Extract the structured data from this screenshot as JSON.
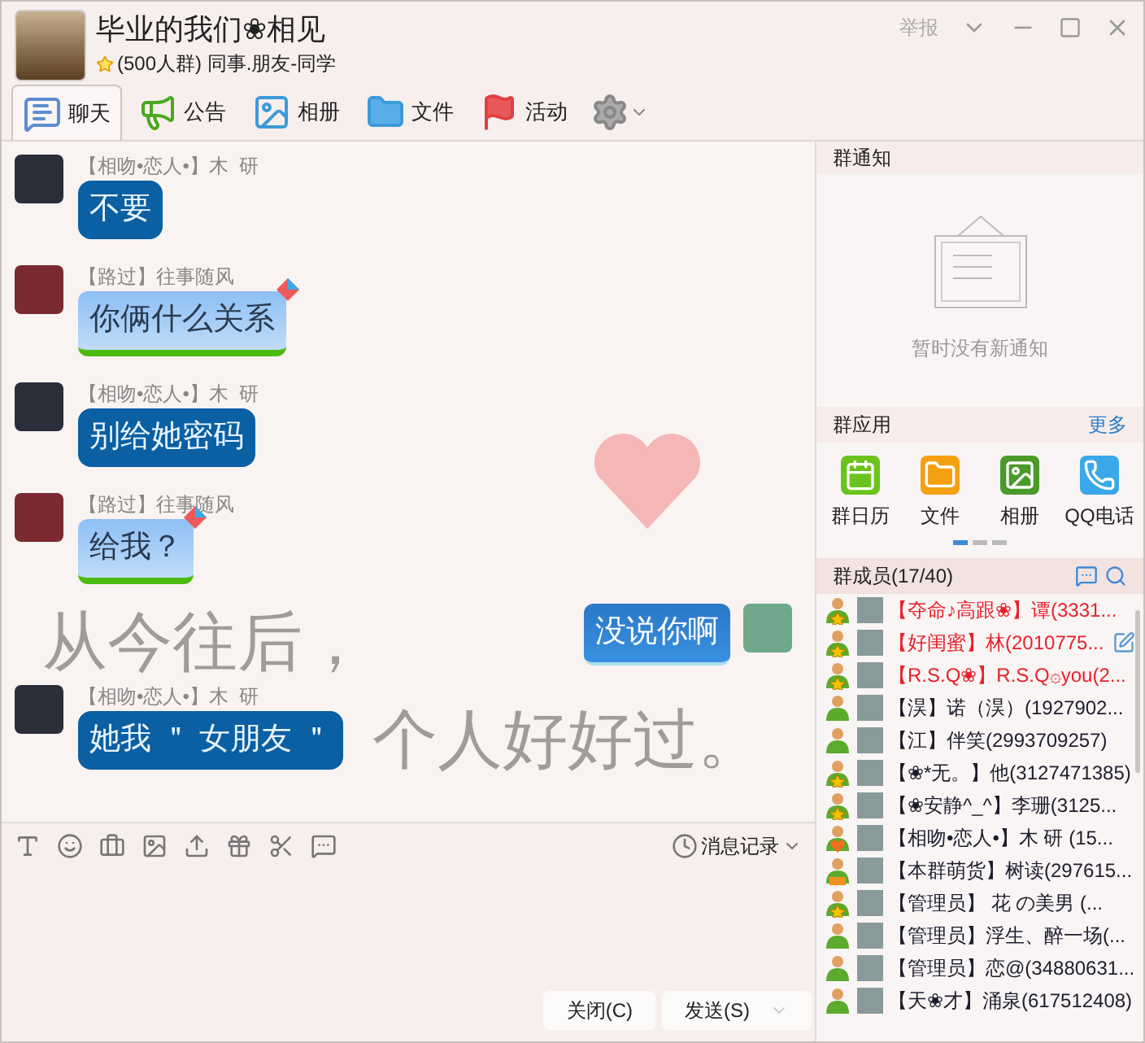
{
  "window": {
    "title": "毕业的我们❀相见",
    "subtitle": "(500人群) 同事.朋友-同学",
    "report": "举报"
  },
  "tabs": [
    {
      "label": "聊天",
      "selected": true
    },
    {
      "label": "公告",
      "selected": false
    },
    {
      "label": "相册",
      "selected": false
    },
    {
      "label": "文件",
      "selected": false
    },
    {
      "label": "活动",
      "selected": false
    }
  ],
  "wallpaper_text": [
    "从今往后，",
    "个人好好过。"
  ],
  "messages": [
    {
      "sender": "【相吻•恋人•】木  研",
      "text": "不要",
      "kind": "dark"
    },
    {
      "sender": "【路过】往事随风",
      "text": "你俩什么关系",
      "kind": "kite"
    },
    {
      "sender": "【相吻•恋人•】木  研",
      "text": "别给她密码",
      "kind": "dark"
    },
    {
      "sender": "【路过】往事随风",
      "text": "给我？",
      "kind": "kite"
    },
    {
      "text": "没说你啊",
      "kind": "self"
    },
    {
      "sender": "【相吻•恋人•】木  研",
      "text": "她我 ＂ 女朋友 ＂",
      "kind": "dark"
    }
  ],
  "toolbar": {
    "history": "消息记录"
  },
  "buttons": [
    {
      "label": "关闭(C)",
      "dropdown": false
    },
    {
      "label": "发送(S)",
      "dropdown": true
    }
  ],
  "notice": {
    "title": "群通知",
    "empty": "暂时没有新通知"
  },
  "apps": {
    "title": "群应用",
    "more": "更多",
    "items": [
      {
        "label": "群日历"
      },
      {
        "label": "文件"
      },
      {
        "label": "相册"
      },
      {
        "label": "QQ电话"
      }
    ],
    "pages": [
      {
        "selected": true
      },
      {
        "selected": false
      },
      {
        "selected": false
      }
    ]
  },
  "members": {
    "title": "群成员(17/40)",
    "items": [
      {
        "name": "【夺命♪高跟❀】谭(3331...",
        "kind": "star",
        "color": "#e8202a",
        "edit": false
      },
      {
        "name": "【好闺蜜】林(2010775...",
        "kind": "star",
        "color": "#e8202a",
        "edit": true
      },
      {
        "name": "【R.S.Q❀】R.S.Q۞you(2...",
        "kind": "star",
        "color": "#e8202a",
        "edit": false
      },
      {
        "name": "【淏】诺（淏）(1927902...",
        "kind": "plain",
        "color": "#1c1c2c",
        "edit": false
      },
      {
        "name": "【江】伴笑(2993709257)",
        "kind": "plain",
        "color": "#1c1c2c",
        "edit": false
      },
      {
        "name": "【❀*无。】他(3127471385)",
        "kind": "star",
        "color": "#1c1c2c",
        "edit": false
      },
      {
        "name": "【❀安静^_^】李珊(3125...",
        "kind": "star",
        "color": "#1c1c2c",
        "edit": false
      },
      {
        "name": "【相吻•恋人•】木 研 (15...",
        "kind": "heart",
        "color": "#1c1c2c",
        "edit": false
      },
      {
        "name": "【本群萌货】树读(297615...",
        "kind": "cake",
        "color": "#1c1c2c",
        "edit": false
      },
      {
        "name": "【管理员】  花  の美男 (...",
        "kind": "star",
        "color": "#1c1c2c",
        "edit": false
      },
      {
        "name": "【管理员】浮生、醉一场(...",
        "kind": "plain",
        "color": "#1c1c2c",
        "edit": false
      },
      {
        "name": "【管理员】恋@(34880631...",
        "kind": "plain",
        "color": "#1c1c2c",
        "edit": false
      },
      {
        "name": "【天❀才】涌泉(617512408)",
        "kind": "plain",
        "color": "#1c1c2c",
        "edit": false
      }
    ]
  }
}
